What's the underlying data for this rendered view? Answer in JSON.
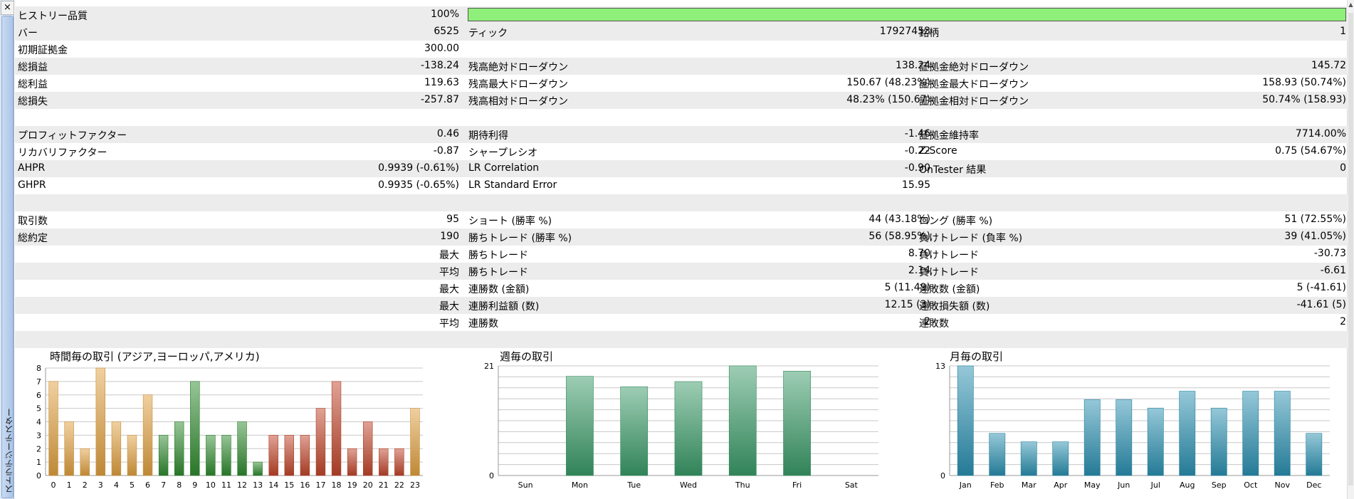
{
  "sidebar": {
    "close_label": "×",
    "tab_label": "ストラテジーテスター"
  },
  "scrollbar": {
    "up_arrow": "▲"
  },
  "rows": [
    {
      "shade": true,
      "l1": "ヒストリー品質",
      "v1": "100%",
      "l2": "",
      "v2": "",
      "l3": "",
      "v3": "",
      "bar": 1.0
    },
    {
      "shade": true,
      "l1": "バー",
      "v1": "6525",
      "l2": "ティック",
      "v2": "17927453",
      "l3": "銘柄",
      "v3": "1"
    },
    {
      "shade": false,
      "l1": "初期証拠金",
      "v1": "300.00",
      "l2": "",
      "v2": "",
      "l3": "",
      "v3": ""
    },
    {
      "shade": true,
      "l1": "総損益",
      "v1": "-138.24",
      "l2": "残高絶対ドローダウン",
      "v2": "138.24",
      "l3": "証拠金絶対ドローダウン",
      "v3": "145.72"
    },
    {
      "shade": false,
      "l1": "総利益",
      "v1": "119.63",
      "l2": "残高最大ドローダウン",
      "v2": "150.67 (48.23%)",
      "l3": "証拠金最大ドローダウン",
      "v3": "158.93 (50.74%)"
    },
    {
      "shade": true,
      "l1": "総損失",
      "v1": "-257.87",
      "l2": "残高相対ドローダウン",
      "v2": "48.23% (150.67)",
      "l3": "証拠金相対ドローダウン",
      "v3": "50.74% (158.93)"
    },
    {
      "shade": false,
      "l1": "",
      "v1": "",
      "l2": "",
      "v2": "",
      "l3": "",
      "v3": ""
    },
    {
      "shade": true,
      "l1": "プロフィットファクター",
      "v1": "0.46",
      "l2": "期待利得",
      "v2": "-1.46",
      "l3": "証拠金維持率",
      "v3": "7714.00%"
    },
    {
      "shade": false,
      "l1": "リカバリファクター",
      "v1": "-0.87",
      "l2": "シャープレシオ",
      "v2": "-0.22",
      "l3": "Z-Score",
      "v3": "0.75 (54.67%)"
    },
    {
      "shade": true,
      "l1": "AHPR",
      "v1": "0.9939 (-0.61%)",
      "l2": "LR Correlation",
      "v2": "-0.90",
      "l3": "OnTester 結果",
      "v3": "0"
    },
    {
      "shade": false,
      "l1": "GHPR",
      "v1": "0.9935 (-0.65%)",
      "l2": "LR Standard Error",
      "v2": "15.95",
      "l3": "",
      "v3": ""
    },
    {
      "shade": true,
      "l1": "",
      "v1": "",
      "l2": "",
      "v2": "",
      "l3": "",
      "v3": ""
    },
    {
      "shade": false,
      "l1": "取引数",
      "v1": "95",
      "l2": "ショート (勝率 %)",
      "v2": "44 (43.18%)",
      "l3": "ロング (勝率 %)",
      "v3": "51 (72.55%)"
    },
    {
      "shade": true,
      "l1": "総約定",
      "v1": "190",
      "l2": "勝ちトレード (勝率 %)",
      "v2": "56 (58.95%)",
      "l3": "負けトレード (負率 %)",
      "v3": "39 (41.05%)"
    },
    {
      "shade": false,
      "l1": "",
      "v1": "最大",
      "l2": "勝ちトレード",
      "v2": "8.70",
      "l3": "負けトレード",
      "v3": "-30.73"
    },
    {
      "shade": true,
      "l1": "",
      "v1": "平均",
      "l2": "勝ちトレード",
      "v2": "2.14",
      "l3": "負けトレード",
      "v3": "-6.61"
    },
    {
      "shade": false,
      "l1": "",
      "v1": "最大",
      "l2": "連勝数 (金額)",
      "v2": "5 (11.49)",
      "l3": "連敗数 (金額)",
      "v3": "5 (-41.61)"
    },
    {
      "shade": true,
      "l1": "",
      "v1": "最大",
      "l2": "連勝利益額 (数)",
      "v2": "12.15 (3)",
      "l3": "連敗損失額 (数)",
      "v3": "-41.61 (5)"
    },
    {
      "shade": false,
      "l1": "",
      "v1": "平均",
      "l2": "連勝数",
      "v2": "2",
      "l3": "連敗数",
      "v3": "2"
    },
    {
      "shade": true,
      "l1": "",
      "v1": "",
      "l2": "",
      "v2": "",
      "l3": "",
      "v3": ""
    }
  ],
  "chart_data": [
    {
      "type": "bar",
      "title": "時間毎の取引 (アジア,ヨーロッパ,アメリカ)",
      "categories": [
        "0",
        "1",
        "2",
        "3",
        "4",
        "5",
        "6",
        "7",
        "8",
        "9",
        "10",
        "11",
        "12",
        "13",
        "14",
        "15",
        "16",
        "17",
        "18",
        "19",
        "20",
        "21",
        "22",
        "23"
      ],
      "values": [
        7,
        4,
        2,
        8,
        4,
        3,
        6,
        3,
        4,
        7,
        3,
        3,
        4,
        1,
        3,
        3,
        3,
        5,
        7,
        2,
        4,
        2,
        2,
        5
      ],
      "colors": [
        "#e0a040",
        "#e0a040",
        "#e0a040",
        "#e0a040",
        "#e0a040",
        "#e0a040",
        "#e0a040",
        "#2f8a2f",
        "#2f8a2f",
        "#2f8a2f",
        "#2f8a2f",
        "#2f8a2f",
        "#2f8a2f",
        "#2f8a2f",
        "#c0452a",
        "#c0452a",
        "#c0452a",
        "#c0452a",
        "#c0452a",
        "#c0452a",
        "#c0452a",
        "#c0452a",
        "#c0452a",
        "#e0a040"
      ],
      "yticks": [
        0,
        1,
        2,
        3,
        4,
        5,
        6,
        7,
        8
      ],
      "ylim": [
        0,
        8
      ]
    },
    {
      "type": "bar",
      "title": "週毎の取引",
      "categories": [
        "Sun",
        "Mon",
        "Tue",
        "Wed",
        "Thu",
        "Fri",
        "Sat"
      ],
      "values": [
        0,
        19,
        17,
        18,
        21,
        20,
        0
      ],
      "colors": [
        "#3a9a68"
      ],
      "yticks": [
        0,
        21
      ],
      "ylim": [
        0,
        21
      ]
    },
    {
      "type": "bar",
      "title": "月毎の取引",
      "categories": [
        "Jan",
        "Feb",
        "Mar",
        "Apr",
        "May",
        "Jun",
        "Jul",
        "Aug",
        "Sep",
        "Oct",
        "Nov",
        "Dec"
      ],
      "values": [
        13,
        5,
        4,
        4,
        9,
        9,
        8,
        10,
        8,
        10,
        10,
        5
      ],
      "colors": [
        "#2a90b0"
      ],
      "yticks": [
        0,
        13
      ],
      "ylim": [
        0,
        13
      ]
    }
  ]
}
